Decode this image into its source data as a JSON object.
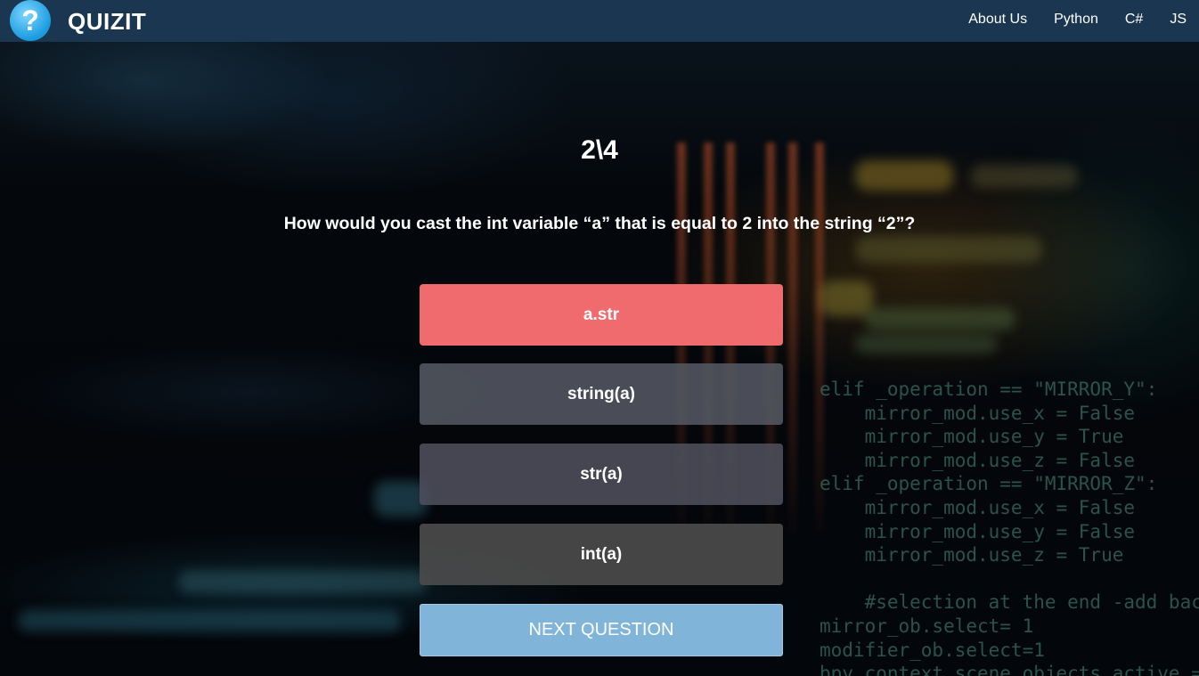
{
  "header": {
    "logo_glyph": "?",
    "brand": "QUIZIT",
    "nav": [
      "About Us",
      "Python",
      "C#",
      "JS"
    ]
  },
  "quiz": {
    "counter": "2\\4",
    "question": "How would you cast the int variable “a” that is equal to 2 into the string “2”?",
    "answers": [
      {
        "label": "a.str",
        "state": "incorrect"
      },
      {
        "label": "string(a)",
        "state": "neutral"
      },
      {
        "label": "str(a)",
        "state": "neutral"
      },
      {
        "label": "int(a)",
        "state": "neutral"
      }
    ],
    "next_label": "NEXT QUESTION"
  },
  "background_code": [
    "elif _operation == \"MIRROR_Y\":",
    "    mirror_mod.use_x = False",
    "    mirror_mod.use_y = True",
    "    mirror_mod.use_z = False",
    "elif _operation == \"MIRROR_Z\":",
    "    mirror_mod.use_x = False",
    "    mirror_mod.use_y = False",
    "    mirror_mod.use_z = True",
    "",
    "    #selection at the end -add back",
    "mirror_ob.select= 1",
    "modifier_ob.select=1",
    "bpy.context.scene.objects.active ="
  ],
  "colors": {
    "header_bg": "#1a3650",
    "incorrect": "#f06b6e",
    "neutral_1": "#4a4d57",
    "neutral_2": "#434651",
    "neutral_3": "#454545",
    "next_bg": "#80b5d9"
  }
}
